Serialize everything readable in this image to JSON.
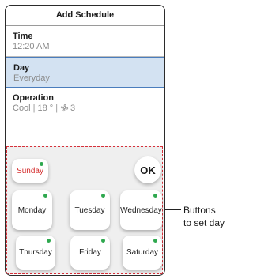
{
  "header": {
    "title": "Add Schedule"
  },
  "settings": {
    "time": {
      "label": "Time",
      "value": "12:20 AM"
    },
    "day": {
      "label": "Day",
      "value": "Everyday"
    },
    "operation": {
      "label": "Operation",
      "mode": "Cool",
      "temperature": "18 °",
      "fan_icon": "fan-icon",
      "fan_speed": "3"
    }
  },
  "day_buttons": {
    "sunday": "Sunday",
    "monday": "Monday",
    "tuesday": "Tuesday",
    "wednesday": "Wednesday",
    "thursday": "Thursday",
    "friday": "Friday",
    "saturday": "Saturday",
    "ok": "OK",
    "selected_indicator_color": "#2fa84f",
    "sunday_color": "#d42a2a"
  },
  "annotation": {
    "line1": "Buttons",
    "line2": "to set day"
  },
  "colors": {
    "selected_row_bg": "#d3e2f2",
    "selected_row_border": "#4a7dbd",
    "dashed_border": "#d6303a"
  }
}
